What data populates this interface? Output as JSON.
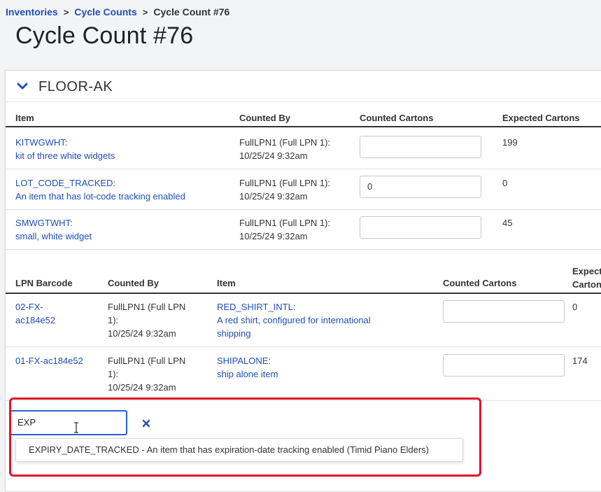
{
  "breadcrumb": {
    "inventories": "Inventories",
    "cycle_counts": "Cycle Counts",
    "current": "Cycle Count #76",
    "sep": ">"
  },
  "page": {
    "title": "Cycle Count #76"
  },
  "zone": {
    "name": "FLOOR-AK"
  },
  "items_table": {
    "headers": {
      "item": "Item",
      "counted_by": "Counted By",
      "counted_cartons": "Counted Cartons",
      "expected_cartons": "Expected Cartons"
    },
    "rows": [
      {
        "code": "KITWGWHT:",
        "desc": "kit of three white widgets",
        "counted_by_1": "FullLPN1 (Full LPN 1):",
        "counted_by_2": "10/25/24 9:32am",
        "counted": "",
        "expected": "199"
      },
      {
        "code": "LOT_CODE_TRACKED:",
        "desc": "An item that has lot-code tracking enabled",
        "counted_by_1": "FullLPN1 (Full LPN 1):",
        "counted_by_2": "10/25/24 9:32am",
        "counted": "0",
        "expected": "0"
      },
      {
        "code": "SMWGTWHT:",
        "desc": "small, white widget",
        "counted_by_1": "FullLPN1 (Full LPN 1):",
        "counted_by_2": "10/25/24 9:32am",
        "counted": "",
        "expected": "45"
      }
    ]
  },
  "lpn_table": {
    "headers": {
      "lpn_barcode": "LPN Barcode",
      "counted_by": "Counted By",
      "item": "Item",
      "counted_cartons": "Counted Cartons",
      "expected_1": "Expect",
      "expected_2": "Carton"
    },
    "rows": [
      {
        "lpn_1": "02-FX-",
        "lpn_2": "ac184e52",
        "cb_1": "FullLPN1 (Full LPN",
        "cb_2": "1):",
        "cb_3": "10/25/24 9:32am",
        "item_code": "RED_SHIRT_INTL:",
        "item_desc_1": "A red shirt, configured for international",
        "item_desc_2": "shipping",
        "counted": "",
        "expected": "0"
      },
      {
        "lpn_1": "01-FX-ac184e52",
        "cb_1": "FullLPN1 (Full LPN",
        "cb_2": "1):",
        "cb_3": "10/25/24 9:32am",
        "item_code": "SHIPALONE:",
        "item_desc_1": "ship alone item",
        "counted": "",
        "expected": "174"
      }
    ]
  },
  "add_item": {
    "search_value": "EXP",
    "suggestion": "EXPIRY_DATE_TRACKED - An item that has expiration-date tracking enabled (Timid Piano Elders)"
  },
  "colors": {
    "link": "#1f4fb5",
    "highlight": "#e0112b",
    "focus": "#2a5fd6"
  },
  "icons": {
    "chevron": "chevron-down-icon",
    "clear": "close-icon",
    "cursor": "text-cursor-icon"
  }
}
